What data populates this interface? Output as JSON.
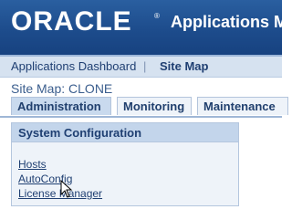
{
  "header": {
    "logo_text": "ORACLE",
    "logo_mark": "®",
    "app_title": "Applications Ma"
  },
  "nav": {
    "dashboard_label": "Applications Dashboard",
    "separator": "|",
    "sitemap_label": "Site Map"
  },
  "page": {
    "title": "Site Map: CLONE"
  },
  "tabs": [
    {
      "label": "Administration",
      "active": true
    },
    {
      "label": "Monitoring",
      "active": false
    },
    {
      "label": "Maintenance",
      "active": false
    }
  ],
  "panel": {
    "title": "System Configuration",
    "links": [
      "Hosts",
      "AutoConfig",
      "License Manager"
    ]
  },
  "colors": {
    "banner": "#1d4c8c",
    "link": "#1f3f72",
    "panel_header": "#c3d5eb",
    "panel_bg": "#eef3f9"
  }
}
